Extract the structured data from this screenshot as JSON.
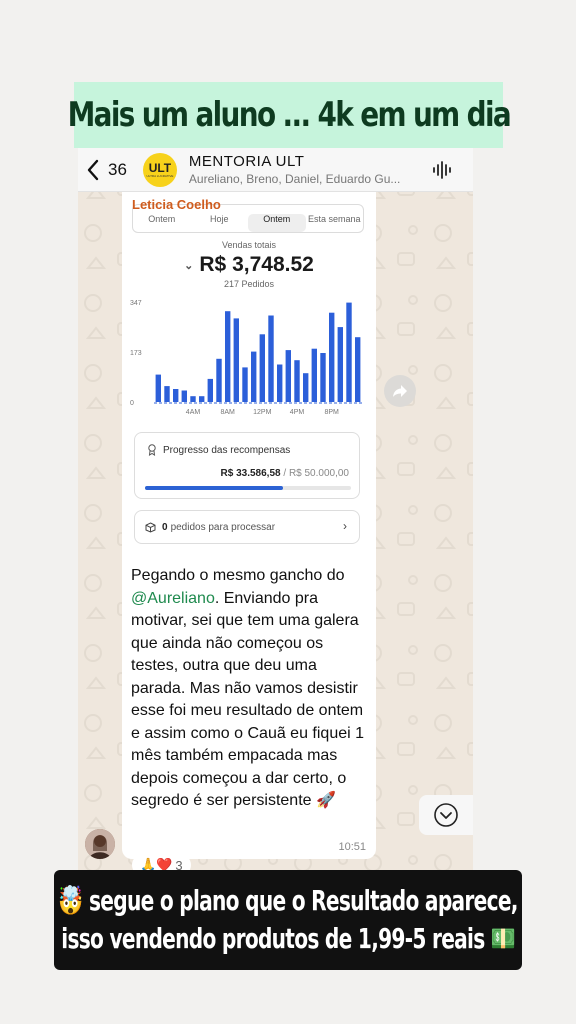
{
  "top_banner": {
    "text": "Mais um aluno ... 4k em um dia"
  },
  "header": {
    "back_count": "36",
    "avatar_text": "ULT",
    "avatar_subtext": "ULTRA LUCRATIVE",
    "group_name": "MENTORIA ULT",
    "members": "Aureliano, Breno, Daniel, Eduardo Gu..."
  },
  "message": {
    "sender": "Leticia Coelho",
    "tabs": [
      "Ontem",
      "Hoje",
      "Ontem",
      "Esta semana"
    ],
    "sales_label": "Vendas totais",
    "amount": "R$ 3,748.52",
    "orders": "217 Pedidos",
    "reward_title": "Progresso das recompensas",
    "reward_current": "R$ 33.586,58",
    "reward_sep": " / ",
    "reward_total": "R$ 50.000,00",
    "reward_progress": 0.67,
    "pending_count": "0",
    "pending_text": "pedidos para processar",
    "text_before": "Pegando o mesmo gancho do ",
    "mention": "@Aureliano",
    "text_after": ". Enviando pra motivar, sei que tem uma galera que ainda não começou os testes, outra que deu uma parada. Mas não vamos desistir esse foi meu resultado de ontem e assim como o Cauã eu fiquei 1 mês também empacada mas depois começou a dar certo, o segredo é ser persistente 🚀",
    "time": "10:51",
    "reactions": "🙏❤️",
    "reactions_count": "3"
  },
  "chart_data": {
    "type": "bar",
    "title": "",
    "y_ticks": [
      "347",
      "173",
      "0"
    ],
    "x_ticks": [
      "4AM",
      "8AM",
      "12PM",
      "4PM",
      "8PM"
    ],
    "ylim": [
      0,
      347
    ],
    "values": [
      95,
      55,
      45,
      40,
      20,
      20,
      80,
      150,
      315,
      290,
      120,
      175,
      235,
      300,
      130,
      180,
      145,
      100,
      185,
      170,
      310,
      260,
      345,
      225
    ],
    "color": "#2c5fd9"
  },
  "bottom_banner": {
    "line1": "🤯 segue o plano que o Resultado aparece,",
    "line2": "isso vendendo produtos de 1,99-5 reais 💵"
  }
}
